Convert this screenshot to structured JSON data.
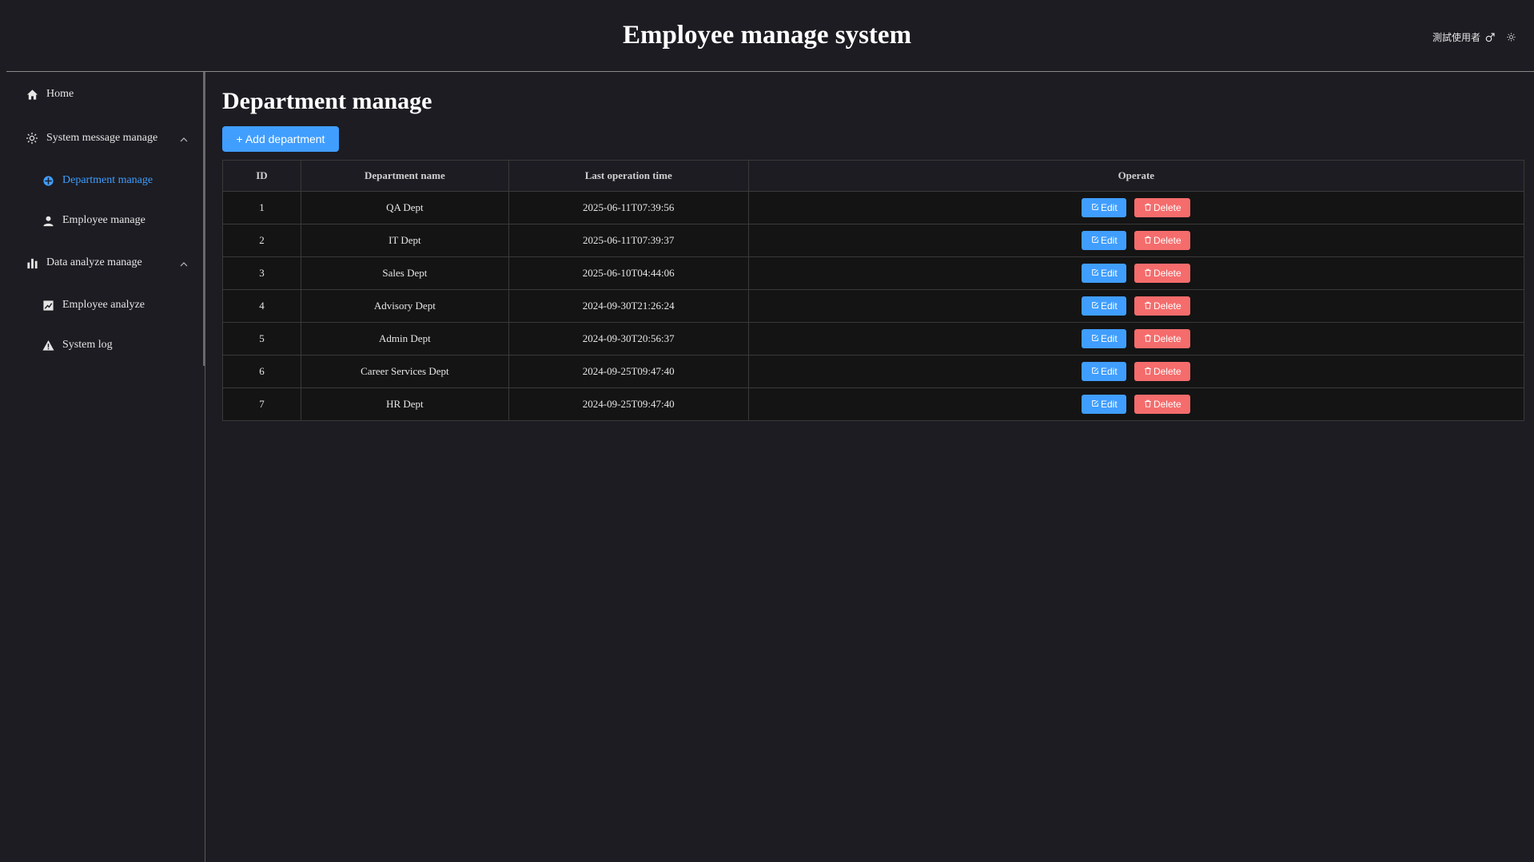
{
  "app": {
    "title": "Employee manage system",
    "user_name": "測試使用者"
  },
  "sidebar": {
    "items": [
      {
        "label": "Home",
        "icon": "home-icon"
      },
      {
        "label": "System message manage",
        "icon": "gear-icon",
        "expanded": true
      },
      {
        "label": "Department manage",
        "icon": "department-icon",
        "active": true
      },
      {
        "label": "Employee manage",
        "icon": "user-icon"
      },
      {
        "label": "Data analyze manage",
        "icon": "bar-chart-icon",
        "expanded": true
      },
      {
        "label": "Employee analyze",
        "icon": "trend-chart-icon"
      },
      {
        "label": "System log",
        "icon": "warning-icon"
      }
    ]
  },
  "page": {
    "title": "Department manage",
    "add_button": "+ Add department"
  },
  "table": {
    "headers": [
      "ID",
      "Department name",
      "Last operation time",
      "Operate"
    ],
    "rows": [
      {
        "id": "1",
        "name": "QA Dept",
        "time": "2025-06-11T07:39:56"
      },
      {
        "id": "2",
        "name": "IT Dept",
        "time": "2025-06-11T07:39:37"
      },
      {
        "id": "3",
        "name": "Sales Dept",
        "time": "2025-06-10T04:44:06"
      },
      {
        "id": "4",
        "name": "Advisory Dept",
        "time": "2024-09-30T21:26:24"
      },
      {
        "id": "5",
        "name": "Admin Dept",
        "time": "2024-09-30T20:56:37"
      },
      {
        "id": "6",
        "name": "Career Services Dept",
        "time": "2024-09-25T09:47:40"
      },
      {
        "id": "7",
        "name": "HR Dept",
        "time": "2024-09-25T09:47:40"
      }
    ],
    "edit_label": "Edit",
    "delete_label": "Delete"
  },
  "colors": {
    "background": "#1c1c22",
    "accent": "#409eff",
    "danger": "#f56c6c",
    "cell_bg": "#141414"
  }
}
